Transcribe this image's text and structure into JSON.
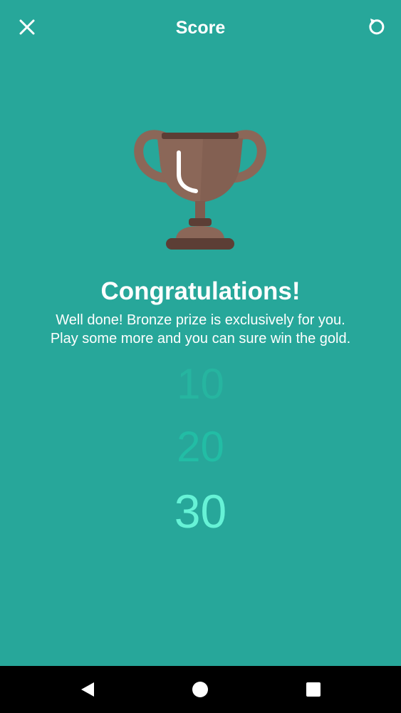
{
  "header": {
    "title": "Score",
    "close_icon": "close-icon",
    "refresh_icon": "refresh-icon"
  },
  "trophy": {
    "icon": "bronze-trophy-icon",
    "color": "#8B6758"
  },
  "message": {
    "heading": "Congratulations!",
    "line1": "Well done! Bronze prize is exclusively for you.",
    "line2": "Play some more and you can sure win the gold."
  },
  "scores": [
    "10",
    "20",
    "30"
  ],
  "navbar": {
    "back_icon": "back-triangle-icon",
    "home_icon": "home-circle-icon",
    "recent_icon": "recent-apps-square-icon"
  },
  "colors": {
    "background": "#27A79A",
    "highlight": "#66F2D6"
  }
}
